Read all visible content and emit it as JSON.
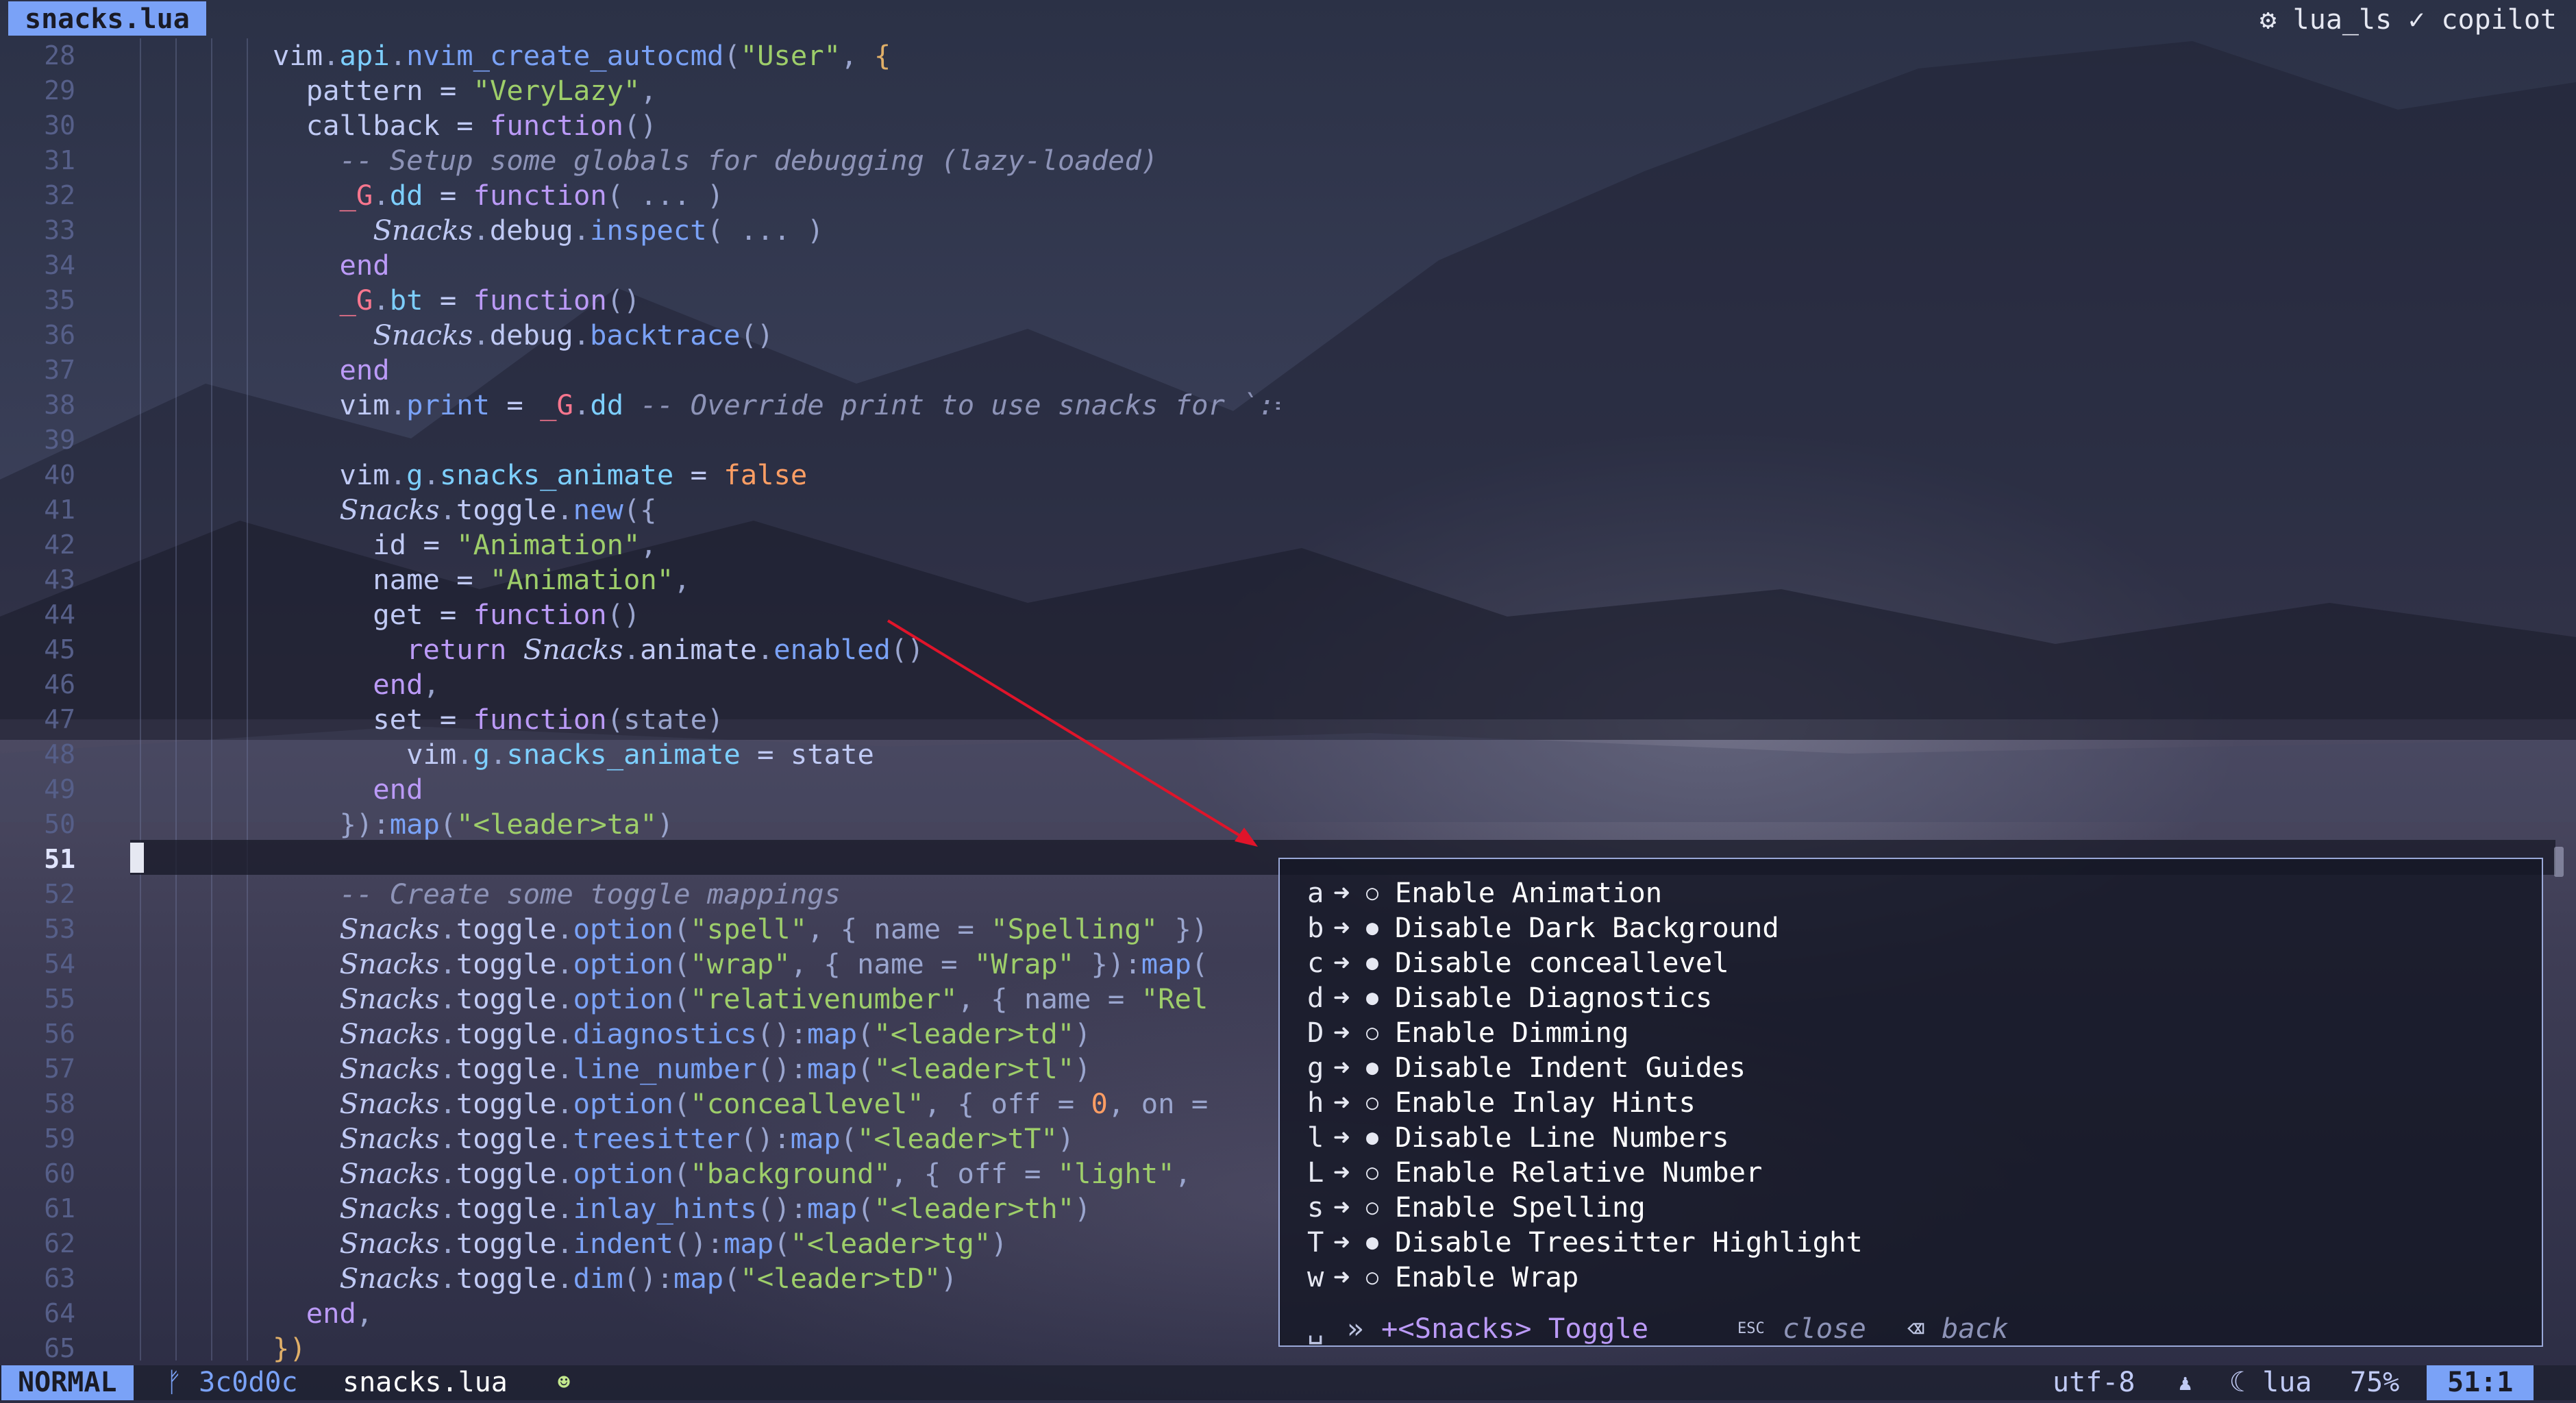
{
  "tab": {
    "title": "snacks.lua"
  },
  "lsp_status": "⚙ lua_ls ✓ copilot",
  "line_numbers": [
    "28",
    "29",
    "30",
    "31",
    "32",
    "33",
    "34",
    "35",
    "36",
    "37",
    "38",
    "39",
    "40",
    "41",
    "42",
    "43",
    "44",
    "45",
    "46",
    "47",
    "48",
    "49",
    "50",
    "51",
    "52",
    "53",
    "54",
    "55",
    "56",
    "57",
    "58",
    "59",
    "60",
    "61",
    "62",
    "63",
    "64",
    "65"
  ],
  "current_line": "51",
  "code_lines": [
    [
      {
        "t": "vim",
        "c": ""
      },
      {
        "t": ".",
        "c": "p"
      },
      {
        "t": "api",
        "c": "m"
      },
      {
        "t": ".",
        "c": "p"
      },
      {
        "t": "nvim_create_autocmd",
        "c": "f"
      },
      {
        "t": "(",
        "c": "p"
      },
      {
        "t": "\"User\"",
        "c": "s"
      },
      {
        "t": ", ",
        "c": "p"
      },
      {
        "t": "{",
        "c": "br"
      }
    ],
    [
      {
        "t": "  pattern = ",
        "c": ""
      },
      {
        "t": "\"VeryLazy\"",
        "c": "s"
      },
      {
        "t": ",",
        "c": "p"
      }
    ],
    [
      {
        "t": "  callback = ",
        "c": ""
      },
      {
        "t": "function",
        "c": "k"
      },
      {
        "t": "()",
        "c": "p"
      }
    ],
    [
      {
        "t": "    -- Setup some globals for debugging (lazy-loaded)",
        "c": "c"
      }
    ],
    [
      {
        "t": "    _G",
        "c": "g"
      },
      {
        "t": ".",
        "c": "p"
      },
      {
        "t": "dd",
        "c": "m"
      },
      {
        "t": " = ",
        "c": ""
      },
      {
        "t": "function",
        "c": "k"
      },
      {
        "t": "( ... )",
        "c": "p"
      }
    ],
    [
      {
        "t": "      ",
        "c": ""
      },
      {
        "t": "Snacks",
        "c": "sn"
      },
      {
        "t": ".",
        "c": "p"
      },
      {
        "t": "debug",
        "c": ""
      },
      {
        "t": ".",
        "c": "p"
      },
      {
        "t": "inspect",
        "c": "f"
      },
      {
        "t": "( ... )",
        "c": "p"
      }
    ],
    [
      {
        "t": "    end",
        "c": "k"
      }
    ],
    [
      {
        "t": "    _G",
        "c": "g"
      },
      {
        "t": ".",
        "c": "p"
      },
      {
        "t": "bt",
        "c": "m"
      },
      {
        "t": " = ",
        "c": ""
      },
      {
        "t": "function",
        "c": "k"
      },
      {
        "t": "()",
        "c": "p"
      }
    ],
    [
      {
        "t": "      ",
        "c": ""
      },
      {
        "t": "Snacks",
        "c": "sn"
      },
      {
        "t": ".",
        "c": "p"
      },
      {
        "t": "debug",
        "c": ""
      },
      {
        "t": ".",
        "c": "p"
      },
      {
        "t": "backtrace",
        "c": "f"
      },
      {
        "t": "()",
        "c": "p"
      }
    ],
    [
      {
        "t": "    end",
        "c": "k"
      }
    ],
    [
      {
        "t": "    vim",
        "c": ""
      },
      {
        "t": ".",
        "c": "p"
      },
      {
        "t": "print",
        "c": "f"
      },
      {
        "t": " = ",
        "c": ""
      },
      {
        "t": "_G",
        "c": "g"
      },
      {
        "t": ".",
        "c": "p"
      },
      {
        "t": "dd",
        "c": "m"
      },
      {
        "t": " -- Override print to use snacks for `:=` command",
        "c": "c"
      }
    ],
    [
      {
        "t": "",
        "c": ""
      }
    ],
    [
      {
        "t": "    vim",
        "c": ""
      },
      {
        "t": ".",
        "c": "p"
      },
      {
        "t": "g",
        "c": "m"
      },
      {
        "t": ".",
        "c": "p"
      },
      {
        "t": "snacks_animate",
        "c": "m"
      },
      {
        "t": " = ",
        "c": ""
      },
      {
        "t": "false",
        "c": "b"
      }
    ],
    [
      {
        "t": "    ",
        "c": ""
      },
      {
        "t": "Snacks",
        "c": "sn"
      },
      {
        "t": ".",
        "c": "p"
      },
      {
        "t": "toggle",
        "c": ""
      },
      {
        "t": ".",
        "c": "p"
      },
      {
        "t": "new",
        "c": "f"
      },
      {
        "t": "({",
        "c": "p"
      }
    ],
    [
      {
        "t": "      id = ",
        "c": ""
      },
      {
        "t": "\"Animation\"",
        "c": "s"
      },
      {
        "t": ",",
        "c": "p"
      }
    ],
    [
      {
        "t": "      name = ",
        "c": ""
      },
      {
        "t": "\"Animation\"",
        "c": "s"
      },
      {
        "t": ",",
        "c": "p"
      }
    ],
    [
      {
        "t": "      get = ",
        "c": ""
      },
      {
        "t": "function",
        "c": "k"
      },
      {
        "t": "()",
        "c": "p"
      }
    ],
    [
      {
        "t": "        return ",
        "c": "k"
      },
      {
        "t": "Snacks",
        "c": "sn"
      },
      {
        "t": ".",
        "c": "p"
      },
      {
        "t": "animate",
        "c": ""
      },
      {
        "t": ".",
        "c": "p"
      },
      {
        "t": "enabled",
        "c": "f"
      },
      {
        "t": "()",
        "c": "p"
      }
    ],
    [
      {
        "t": "      end",
        "c": "k"
      },
      {
        "t": ",",
        "c": "p"
      }
    ],
    [
      {
        "t": "      set = ",
        "c": ""
      },
      {
        "t": "function",
        "c": "k"
      },
      {
        "t": "(state)",
        "c": "p"
      }
    ],
    [
      {
        "t": "        vim",
        "c": ""
      },
      {
        "t": ".",
        "c": "p"
      },
      {
        "t": "g",
        "c": "m"
      },
      {
        "t": ".",
        "c": "p"
      },
      {
        "t": "snacks_animate",
        "c": "m"
      },
      {
        "t": " = state",
        "c": ""
      }
    ],
    [
      {
        "t": "      end",
        "c": "k"
      }
    ],
    [
      {
        "t": "    })",
        "c": "p"
      },
      {
        "t": ":",
        "c": "p"
      },
      {
        "t": "map",
        "c": "f"
      },
      {
        "t": "(",
        "c": "p"
      },
      {
        "t": "\"<leader>ta\"",
        "c": "s"
      },
      {
        "t": ")",
        "c": "p"
      }
    ],
    [
      {
        "t": "",
        "c": ""
      }
    ],
    [
      {
        "t": "    -- Create some toggle mappings",
        "c": "c"
      }
    ],
    [
      {
        "t": "    ",
        "c": ""
      },
      {
        "t": "Snacks",
        "c": "sn"
      },
      {
        "t": ".",
        "c": "p"
      },
      {
        "t": "toggle",
        "c": ""
      },
      {
        "t": ".",
        "c": "p"
      },
      {
        "t": "option",
        "c": "f"
      },
      {
        "t": "(",
        "c": "p"
      },
      {
        "t": "\"spell\"",
        "c": "s"
      },
      {
        "t": ", { name = ",
        "c": "p"
      },
      {
        "t": "\"Spelling\"",
        "c": "s"
      },
      {
        "t": " })",
        "c": "p"
      }
    ],
    [
      {
        "t": "    ",
        "c": ""
      },
      {
        "t": "Snacks",
        "c": "sn"
      },
      {
        "t": ".",
        "c": "p"
      },
      {
        "t": "toggle",
        "c": ""
      },
      {
        "t": ".",
        "c": "p"
      },
      {
        "t": "option",
        "c": "f"
      },
      {
        "t": "(",
        "c": "p"
      },
      {
        "t": "\"wrap\"",
        "c": "s"
      },
      {
        "t": ", { name = ",
        "c": "p"
      },
      {
        "t": "\"Wrap\"",
        "c": "s"
      },
      {
        "t": " }):",
        "c": "p"
      },
      {
        "t": "map",
        "c": "f"
      },
      {
        "t": "(",
        "c": "p"
      }
    ],
    [
      {
        "t": "    ",
        "c": ""
      },
      {
        "t": "Snacks",
        "c": "sn"
      },
      {
        "t": ".",
        "c": "p"
      },
      {
        "t": "toggle",
        "c": ""
      },
      {
        "t": ".",
        "c": "p"
      },
      {
        "t": "option",
        "c": "f"
      },
      {
        "t": "(",
        "c": "p"
      },
      {
        "t": "\"relativenumber\"",
        "c": "s"
      },
      {
        "t": ", { name = ",
        "c": "p"
      },
      {
        "t": "\"Rel",
        "c": "s"
      }
    ],
    [
      {
        "t": "    ",
        "c": ""
      },
      {
        "t": "Snacks",
        "c": "sn"
      },
      {
        "t": ".",
        "c": "p"
      },
      {
        "t": "toggle",
        "c": ""
      },
      {
        "t": ".",
        "c": "p"
      },
      {
        "t": "diagnostics",
        "c": "f"
      },
      {
        "t": "():",
        "c": "p"
      },
      {
        "t": "map",
        "c": "f"
      },
      {
        "t": "(",
        "c": "p"
      },
      {
        "t": "\"<leader>td\"",
        "c": "s"
      },
      {
        "t": ")",
        "c": "p"
      }
    ],
    [
      {
        "t": "    ",
        "c": ""
      },
      {
        "t": "Snacks",
        "c": "sn"
      },
      {
        "t": ".",
        "c": "p"
      },
      {
        "t": "toggle",
        "c": ""
      },
      {
        "t": ".",
        "c": "p"
      },
      {
        "t": "line_number",
        "c": "f"
      },
      {
        "t": "():",
        "c": "p"
      },
      {
        "t": "map",
        "c": "f"
      },
      {
        "t": "(",
        "c": "p"
      },
      {
        "t": "\"<leader>tl\"",
        "c": "s"
      },
      {
        "t": ")",
        "c": "p"
      }
    ],
    [
      {
        "t": "    ",
        "c": ""
      },
      {
        "t": "Snacks",
        "c": "sn"
      },
      {
        "t": ".",
        "c": "p"
      },
      {
        "t": "toggle",
        "c": ""
      },
      {
        "t": ".",
        "c": "p"
      },
      {
        "t": "option",
        "c": "f"
      },
      {
        "t": "(",
        "c": "p"
      },
      {
        "t": "\"conceallevel\"",
        "c": "s"
      },
      {
        "t": ", { off = ",
        "c": "p"
      },
      {
        "t": "0",
        "c": "b"
      },
      {
        "t": ", on =",
        "c": "p"
      }
    ],
    [
      {
        "t": "    ",
        "c": ""
      },
      {
        "t": "Snacks",
        "c": "sn"
      },
      {
        "t": ".",
        "c": "p"
      },
      {
        "t": "toggle",
        "c": ""
      },
      {
        "t": ".",
        "c": "p"
      },
      {
        "t": "treesitter",
        "c": "f"
      },
      {
        "t": "():",
        "c": "p"
      },
      {
        "t": "map",
        "c": "f"
      },
      {
        "t": "(",
        "c": "p"
      },
      {
        "t": "\"<leader>tT\"",
        "c": "s"
      },
      {
        "t": ")",
        "c": "p"
      }
    ],
    [
      {
        "t": "    ",
        "c": ""
      },
      {
        "t": "Snacks",
        "c": "sn"
      },
      {
        "t": ".",
        "c": "p"
      },
      {
        "t": "toggle",
        "c": ""
      },
      {
        "t": ".",
        "c": "p"
      },
      {
        "t": "option",
        "c": "f"
      },
      {
        "t": "(",
        "c": "p"
      },
      {
        "t": "\"background\"",
        "c": "s"
      },
      {
        "t": ", { off = ",
        "c": "p"
      },
      {
        "t": "\"light\"",
        "c": "s"
      },
      {
        "t": ",",
        "c": "p"
      }
    ],
    [
      {
        "t": "    ",
        "c": ""
      },
      {
        "t": "Snacks",
        "c": "sn"
      },
      {
        "t": ".",
        "c": "p"
      },
      {
        "t": "toggle",
        "c": ""
      },
      {
        "t": ".",
        "c": "p"
      },
      {
        "t": "inlay_hints",
        "c": "f"
      },
      {
        "t": "():",
        "c": "p"
      },
      {
        "t": "map",
        "c": "f"
      },
      {
        "t": "(",
        "c": "p"
      },
      {
        "t": "\"<leader>th\"",
        "c": "s"
      },
      {
        "t": ")",
        "c": "p"
      }
    ],
    [
      {
        "t": "    ",
        "c": ""
      },
      {
        "t": "Snacks",
        "c": "sn"
      },
      {
        "t": ".",
        "c": "p"
      },
      {
        "t": "toggle",
        "c": ""
      },
      {
        "t": ".",
        "c": "p"
      },
      {
        "t": "indent",
        "c": "f"
      },
      {
        "t": "():",
        "c": "p"
      },
      {
        "t": "map",
        "c": "f"
      },
      {
        "t": "(",
        "c": "p"
      },
      {
        "t": "\"<leader>tg\"",
        "c": "s"
      },
      {
        "t": ")",
        "c": "p"
      }
    ],
    [
      {
        "t": "    ",
        "c": ""
      },
      {
        "t": "Snacks",
        "c": "sn"
      },
      {
        "t": ".",
        "c": "p"
      },
      {
        "t": "toggle",
        "c": ""
      },
      {
        "t": ".",
        "c": "p"
      },
      {
        "t": "dim",
        "c": "f"
      },
      {
        "t": "():",
        "c": "p"
      },
      {
        "t": "map",
        "c": "f"
      },
      {
        "t": "(",
        "c": "p"
      },
      {
        "t": "\"<leader>tD\"",
        "c": "s"
      },
      {
        "t": ")",
        "c": "p"
      }
    ],
    [
      {
        "t": "  end",
        "c": "k"
      },
      {
        "t": ",",
        "c": "p"
      }
    ],
    [
      {
        "t": "})",
        "c": "br"
      }
    ]
  ],
  "which_key": {
    "items": [
      {
        "key": "a",
        "state": "○",
        "desc": "Enable Animation"
      },
      {
        "key": "b",
        "state": "●",
        "desc": "Disable Dark Background"
      },
      {
        "key": "c",
        "state": "●",
        "desc": "Disable conceallevel"
      },
      {
        "key": "d",
        "state": "●",
        "desc": "Disable Diagnostics"
      },
      {
        "key": "D",
        "state": "○",
        "desc": "Enable Dimming"
      },
      {
        "key": "g",
        "state": "●",
        "desc": "Disable Indent Guides"
      },
      {
        "key": "h",
        "state": "○",
        "desc": "Enable Inlay Hints"
      },
      {
        "key": "l",
        "state": "●",
        "desc": "Disable Line Numbers"
      },
      {
        "key": "L",
        "state": "○",
        "desc": "Enable Relative Number"
      },
      {
        "key": "s",
        "state": "○",
        "desc": "Enable Spelling"
      },
      {
        "key": "T",
        "state": "●",
        "desc": "Disable Treesitter Highlight"
      },
      {
        "key": "w",
        "state": "○",
        "desc": "Enable Wrap"
      }
    ],
    "arrow": "➜",
    "footer": {
      "space_icon": "␣",
      "group_marker": "»",
      "group_label": "+<Snacks> Toggle",
      "esc_icon": "ESC",
      "close_label": "close",
      "back_icon": "⌫",
      "back_label": "back"
    }
  },
  "statusline": {
    "mode": "NORMAL",
    "branch_icon": "ᚠ",
    "branch": "3c0d0c",
    "filename": "snacks.lua",
    "diag_icon": "☻",
    "encoding": "utf-8",
    "lsp_icon": "♟",
    "filetype_icon": "☾",
    "filetype": "lua",
    "percent": "75%",
    "position": "51:1"
  },
  "colors": {
    "accent": "#7aa2f7",
    "keyword": "#bb9af7",
    "string": "#9ece6a",
    "comment": "#8d93b7",
    "arrow": "#e0142a"
  }
}
